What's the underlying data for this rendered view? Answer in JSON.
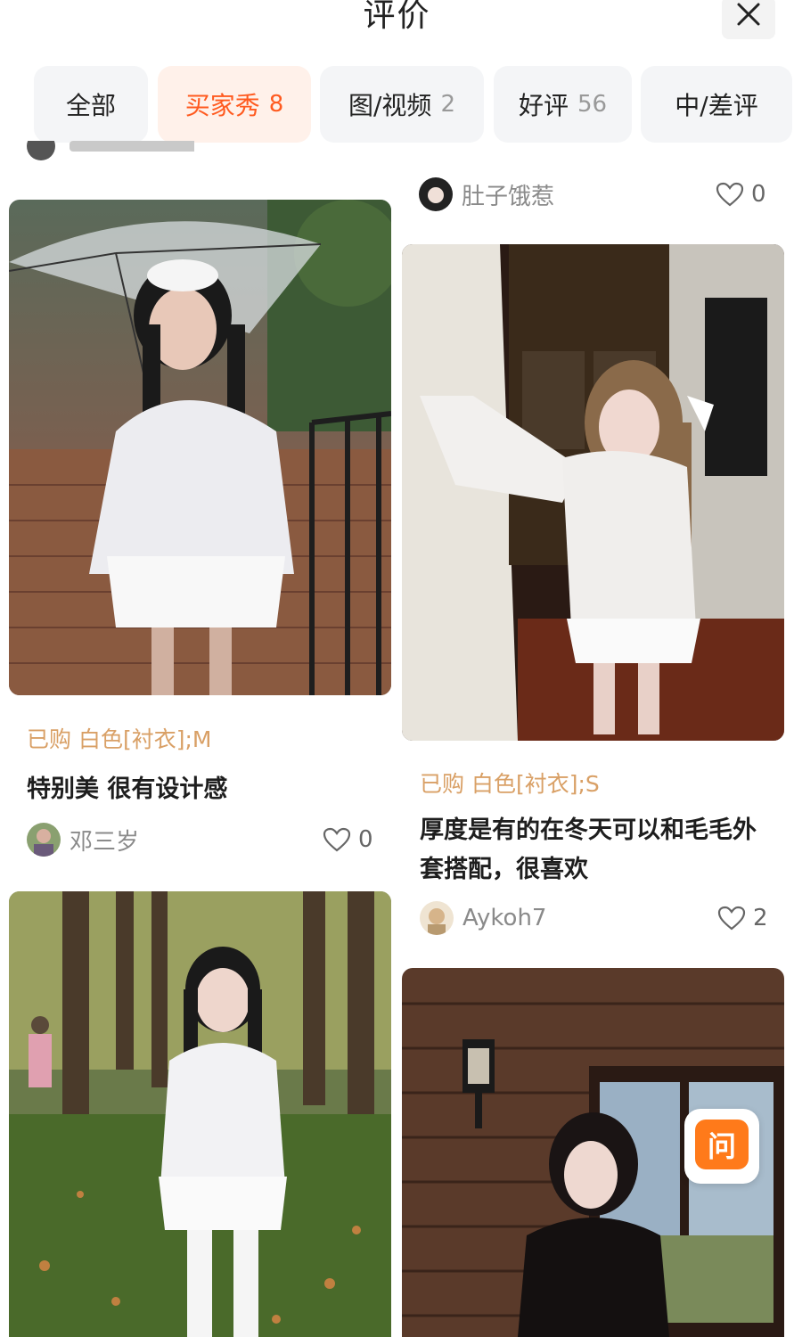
{
  "header": {
    "title": "评价"
  },
  "tabs": [
    {
      "label": "全部",
      "count": ""
    },
    {
      "label": "买家秀",
      "count": "8"
    },
    {
      "label": "图/视频",
      "count": "2"
    },
    {
      "label": "好评",
      "count": "56"
    },
    {
      "label": "中/差评",
      "count": ""
    }
  ],
  "reviews": [
    {
      "variant_label": "已购",
      "variant": "白色[衬衣];M",
      "text": "特别美 很有设计感",
      "author": "邓三岁",
      "likes": "0"
    },
    {
      "author": "肚子饿惹",
      "likes": "0"
    },
    {
      "variant_label": "已购",
      "variant": "白色[衬衣];S",
      "text_line1": "厚度是有的在冬天可以和毛毛外",
      "text_line2": "套搭配，很喜欢",
      "author": "Aykoh7",
      "likes": "2"
    }
  ],
  "ask_button": {
    "label": "问"
  },
  "colors": {
    "accent": "#ff5a1f",
    "variant": "#d9a066",
    "tab_bg": "#f4f5f7",
    "active_tab_bg": "#fff1ea"
  }
}
